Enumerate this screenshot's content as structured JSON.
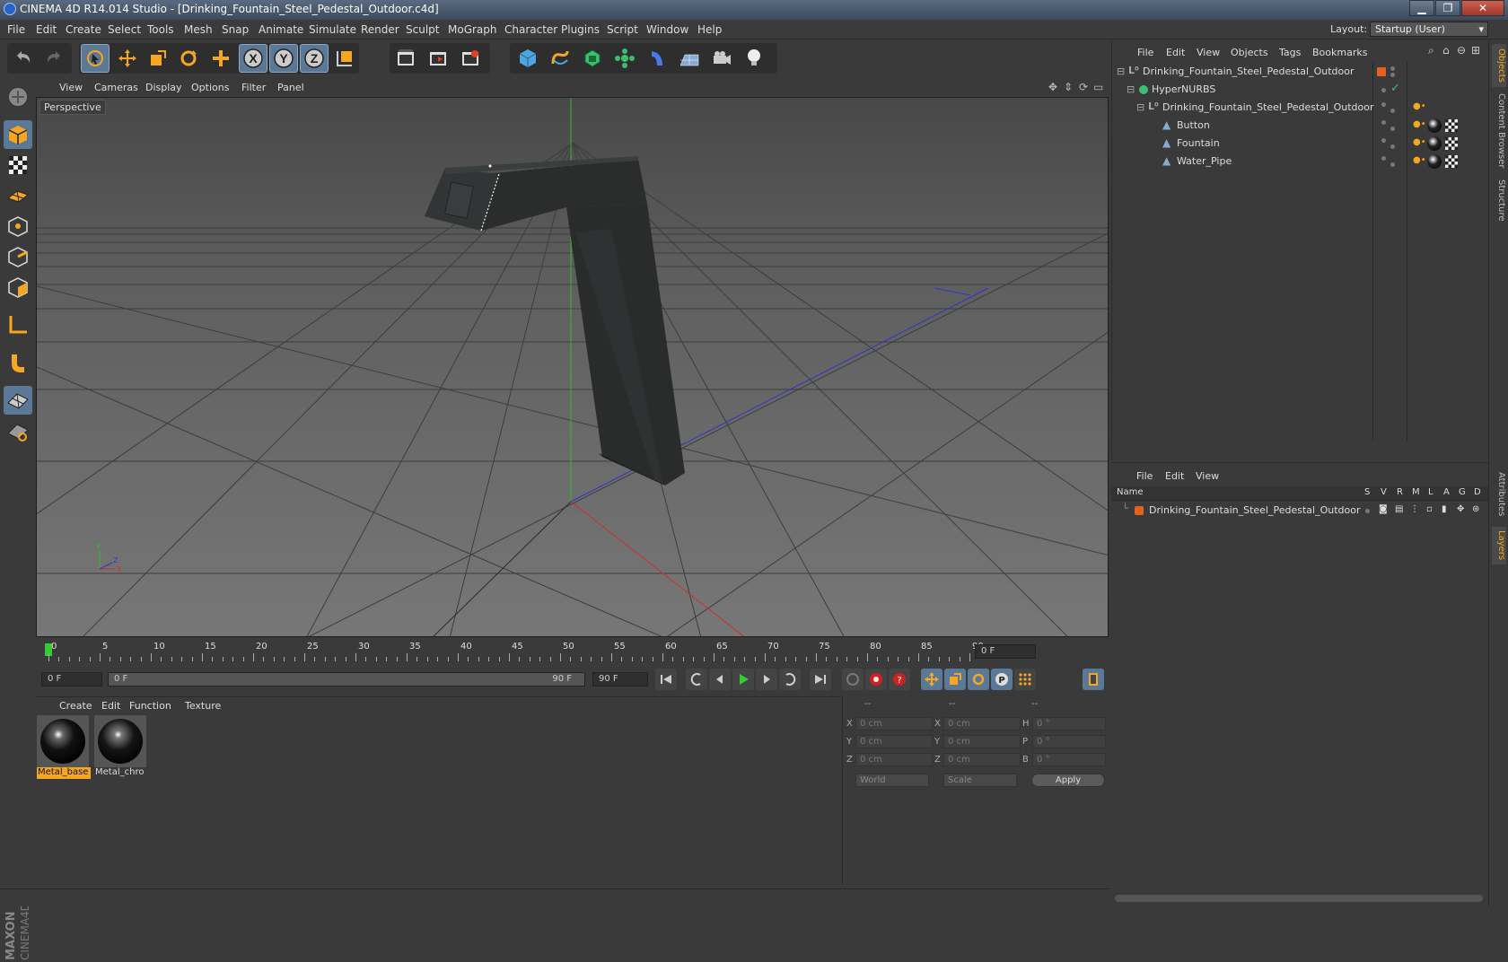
{
  "window": {
    "title": "CINEMA 4D R14.014 Studio - [Drinking_Fountain_Steel_Pedestal_Outdoor.c4d]",
    "minimize": "▁",
    "maximize": "❐",
    "close": "✕"
  },
  "menubar": {
    "items": [
      "File",
      "Edit",
      "Create",
      "Select",
      "Tools",
      "Mesh",
      "Snap",
      "Animate",
      "Simulate",
      "Render",
      "Sculpt",
      "MoGraph",
      "Character",
      "Plugins",
      "Script",
      "Window",
      "Help"
    ],
    "layout_label": "Layout:",
    "layout_value": "Startup (User)"
  },
  "toolbar": {
    "icons": [
      "undo-icon",
      "redo-icon",
      "live-selection-icon",
      "move-icon",
      "scale-icon",
      "rotate-icon",
      "add-object-icon",
      "x-axis-icon",
      "y-axis-icon",
      "z-axis-icon",
      "coordinate-system-icon",
      "render-view-icon",
      "render-picture-viewer-icon",
      "edit-render-settings-icon",
      "cube-icon",
      "spline-icon",
      "nurbs-icon",
      "array-icon",
      "deformer-icon",
      "floor-icon",
      "camera-icon",
      "light-icon"
    ],
    "axis_x": "X",
    "axis_y": "Y",
    "axis_z": "Z"
  },
  "left_tools": [
    "make-editable-icon",
    "model-mode-icon",
    "texture-mode-icon",
    "workplane-icon",
    "points-mode-icon",
    "edges-mode-icon",
    "polygons-mode-icon",
    "axis-mode-icon",
    "magnet-icon",
    "snap-icon",
    "locked-workplane-icon"
  ],
  "viewport": {
    "menu": [
      "View",
      "Cameras",
      "Display",
      "Options",
      "Filter",
      "Panel"
    ],
    "label": "Perspective",
    "axis_x": "X",
    "axis_y": "Y",
    "axis_z": "Z"
  },
  "timeline": {
    "labels": [
      "0",
      "5",
      "10",
      "15",
      "20",
      "25",
      "30",
      "35",
      "40",
      "45",
      "50",
      "55",
      "60",
      "65",
      "70",
      "75",
      "80",
      "85",
      "90"
    ],
    "current_frame": "0 F"
  },
  "playbar": {
    "start_field": "0 F",
    "range_start": "0 F",
    "range_end": "90 F",
    "end_field": "90 F"
  },
  "material_manager": {
    "menu": [
      "Create",
      "Edit",
      "Function",
      "Texture"
    ],
    "materials": [
      {
        "name": "Metal_base",
        "selected": true
      },
      {
        "name": "Metal_chro",
        "selected": false
      }
    ]
  },
  "coordinates": {
    "headers": [
      "--",
      "--",
      "--"
    ],
    "rows": [
      {
        "l1": "X",
        "v1": "0 cm",
        "l2": "X",
        "v2": "0 cm",
        "l3": "H",
        "v3": "0 °"
      },
      {
        "l1": "Y",
        "v1": "0 cm",
        "l2": "Y",
        "v2": "0 cm",
        "l3": "P",
        "v3": "0 °"
      },
      {
        "l1": "Z",
        "v1": "0 cm",
        "l2": "Z",
        "v2": "0 cm",
        "l3": "B",
        "v3": "0 °"
      }
    ],
    "mode": "World",
    "size_mode": "Scale",
    "apply": "Apply"
  },
  "object_manager": {
    "menu": [
      "File",
      "Edit",
      "View",
      "Objects",
      "Tags",
      "Bookmarks"
    ],
    "objects": [
      {
        "name": "Drinking_Fountain_Steel_Pedestal_Outdoor",
        "indent": 0,
        "icon": "null-object-icon"
      },
      {
        "name": "HyperNURBS",
        "indent": 1,
        "icon": "hypernurbs-icon"
      },
      {
        "name": "Drinking_Fountain_Steel_Pedestal_Outdoor",
        "indent": 2,
        "icon": "null-object-icon"
      },
      {
        "name": "Button",
        "indent": 3,
        "icon": "polygon-object-icon"
      },
      {
        "name": "Fountain",
        "indent": 3,
        "icon": "polygon-object-icon"
      },
      {
        "name": "Water_Pipe",
        "indent": 3,
        "icon": "polygon-object-icon"
      }
    ]
  },
  "layer_manager": {
    "menu": [
      "File",
      "Edit",
      "View"
    ],
    "columns": [
      "Name",
      "S",
      "V",
      "R",
      "M",
      "L",
      "A",
      "G",
      "D"
    ],
    "layers": [
      {
        "name": "Drinking_Fountain_Steel_Pedestal_Outdoor",
        "color": "#e0641e"
      }
    ]
  },
  "side_tabs": [
    "Objects",
    "Content Browser",
    "Structure",
    "Attributes",
    "Layers"
  ],
  "brand": "MAXON CINEMA 4D",
  "colors": {
    "selection": "#5c7897",
    "accent_orange": "#f5a623",
    "layer_orange": "#e0641e",
    "axis_x": "#c03030",
    "axis_y": "#30b030",
    "axis_z": "#3030c8"
  }
}
